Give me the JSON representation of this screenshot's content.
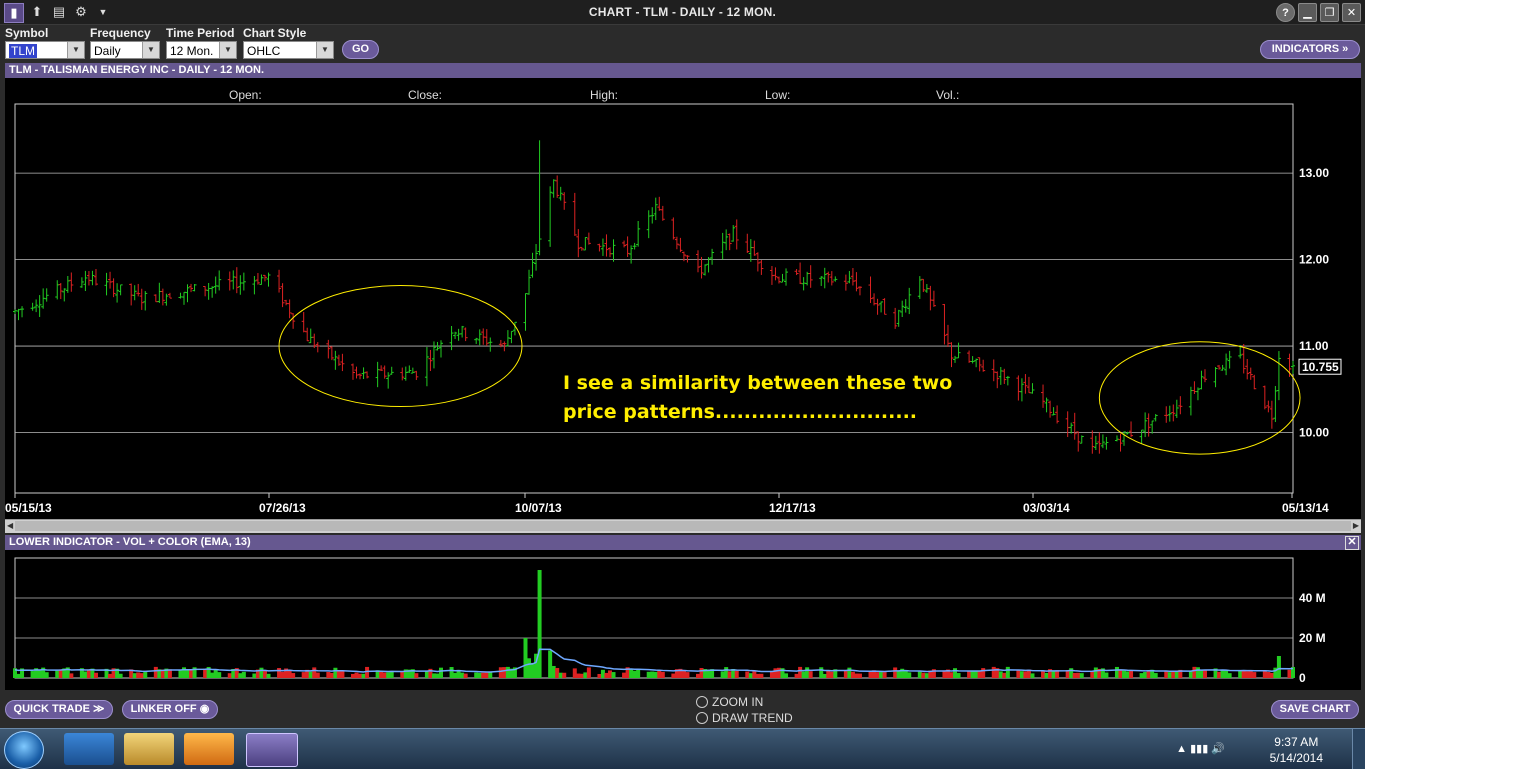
{
  "window": {
    "title": "CHART - TLM - DAILY - 12 MON."
  },
  "toolbar": {
    "symbol_label": "Symbol",
    "symbol_value": "TLM",
    "frequency_label": "Frequency",
    "frequency_value": "Daily",
    "period_label": "Time Period",
    "period_value": "12 Mon.",
    "style_label": "Chart Style",
    "style_value": "OHLC",
    "go_label": "GO",
    "indicators_label": "INDICATORS »"
  },
  "main_chart": {
    "header": "TLM - TALISMAN ENERGY INC - DAILY - 12 MON.",
    "ohlc_labels": [
      "Open:",
      "Close:",
      "High:",
      "Low:",
      "Vol.:"
    ],
    "price_ticks": [
      "13.00",
      "12.00",
      "11.00",
      "10.00"
    ],
    "date_ticks": [
      "05/15/13",
      "07/26/13",
      "10/07/13",
      "12/17/13",
      "03/03/14",
      "05/13/14"
    ],
    "last_price": "10.755",
    "annotation_line1": "I see a similarity between these two",
    "annotation_line2": "price patterns............................"
  },
  "chart_data": [
    {
      "type": "ohlc",
      "title": "TLM - TALISMAN ENERGY INC - DAILY - 12 MON.",
      "x_range": [
        "05/15/13",
        "05/13/14"
      ],
      "ylim": [
        9.3,
        13.8
      ],
      "y_ticks": [
        10.0,
        11.0,
        12.0,
        13.0
      ],
      "last": 10.755,
      "approx_path": [
        {
          "x": "05/15/13",
          "y": 11.4
        },
        {
          "x": "06/04/13",
          "y": 11.8
        },
        {
          "x": "06/20/13",
          "y": 11.55
        },
        {
          "x": "07/26/13",
          "y": 11.8
        },
        {
          "x": "08/06/13",
          "y": 11.1
        },
        {
          "x": "08/20/13",
          "y": 10.65
        },
        {
          "x": "09/06/13",
          "y": 10.7
        },
        {
          "x": "09/16/13",
          "y": 11.2
        },
        {
          "x": "10/01/13",
          "y": 11.0
        },
        {
          "x": "10/07/13",
          "y": 11.6
        },
        {
          "x": "10/15/13",
          "y": 12.9
        },
        {
          "x": "10/22/13",
          "y": 12.2
        },
        {
          "x": "11/05/13",
          "y": 12.1
        },
        {
          "x": "11/13/13",
          "y": 12.6
        },
        {
          "x": "11/25/13",
          "y": 11.85
        },
        {
          "x": "12/05/13",
          "y": 12.3
        },
        {
          "x": "12/17/13",
          "y": 11.8
        },
        {
          "x": "01/08/14",
          "y": 11.75
        },
        {
          "x": "01/20/14",
          "y": 11.3
        },
        {
          "x": "01/27/14",
          "y": 11.8
        },
        {
          "x": "02/05/14",
          "y": 10.9
        },
        {
          "x": "02/20/14",
          "y": 10.65
        },
        {
          "x": "03/03/14",
          "y": 10.35
        },
        {
          "x": "03/17/14",
          "y": 9.8
        },
        {
          "x": "03/28/14",
          "y": 10.0
        },
        {
          "x": "04/10/14",
          "y": 10.3
        },
        {
          "x": "04/20/14",
          "y": 10.75
        },
        {
          "x": "04/28/14",
          "y": 10.85
        },
        {
          "x": "05/07/14",
          "y": 10.2
        },
        {
          "x": "05/09/14",
          "y": 10.9
        },
        {
          "x": "05/13/14",
          "y": 10.755
        }
      ],
      "highlight_ellipses": [
        {
          "from": "07/29/13",
          "to": "10/06/13",
          "ylim": [
            10.3,
            11.7
          ]
        },
        {
          "from": "03/19/14",
          "to": "05/15/14",
          "ylim": [
            9.75,
            11.05
          ]
        }
      ]
    },
    {
      "type": "bar",
      "title": "LOWER INDICATOR - VOL + COLOR (EMA, 13)",
      "ylim": [
        0,
        60
      ],
      "y_ticks": [
        "0",
        "20 M",
        "40 M"
      ],
      "baseline_volume_millions": 4,
      "spikes": [
        {
          "x": "10/07/13",
          "y": 20
        },
        {
          "x": "10/11/13",
          "y": 54
        },
        {
          "x": "05/09/14",
          "y": 11
        }
      ],
      "ema_peak_millions": 14
    }
  ],
  "lower_chart": {
    "header": "LOWER INDICATOR - VOL + COLOR (EMA, 13)",
    "vol_ticks": [
      "40 M",
      "20 M",
      "0"
    ]
  },
  "bottom": {
    "quick_trade": "QUICK TRADE ≫",
    "linker": "LINKER OFF",
    "zoom_in": "ZOOM IN",
    "draw_trend": "DRAW TREND",
    "save_chart": "SAVE CHART"
  },
  "taskbar": {
    "time": "9:37 AM",
    "date": "5/14/2014"
  },
  "colors": {
    "up": "#22cc22",
    "down": "#dd2222",
    "annotation": "#ffee00",
    "ema": "#6fa8ff",
    "panel_header": "#665890"
  }
}
